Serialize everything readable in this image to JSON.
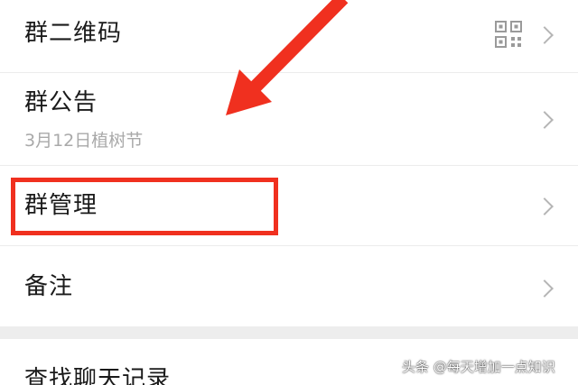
{
  "rows": [
    {
      "title": "群二维码",
      "icon": "qr-code-icon"
    },
    {
      "title": "群公告",
      "subtitle": "3月12日植树节"
    },
    {
      "title": "群管理"
    },
    {
      "title": "备注"
    },
    {
      "title": "查找聊天记录"
    }
  ],
  "watermark": "头条 @每天增加一点知识",
  "colors": {
    "annotation_red": "#f0301f",
    "section_gap": "#ededed",
    "subtitle_gray": "#a9a9a9",
    "chevron_gray": "#b5b5b5"
  }
}
